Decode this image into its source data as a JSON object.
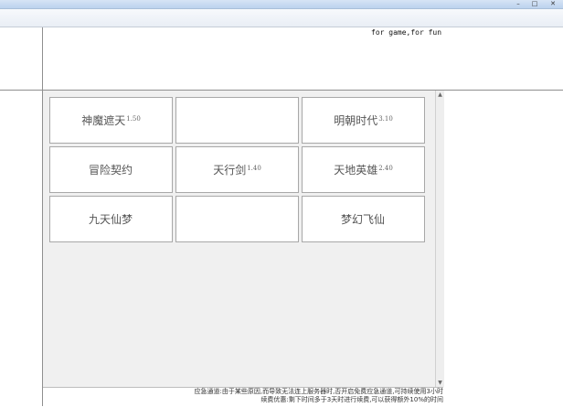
{
  "window": {
    "min_glyph": "–",
    "max_glyph": "□",
    "close_glyph": "✕"
  },
  "header": {
    "tagline": "for game,for fun"
  },
  "games": [
    {
      "name": "神魔遮天",
      "version": "1.50"
    },
    {
      "name": "",
      "version": ""
    },
    {
      "name": "明朝时代",
      "version": "3.10"
    },
    {
      "name": "冒险契约",
      "version": ""
    },
    {
      "name": "天行剑",
      "version": "1.40"
    },
    {
      "name": "天地英雄",
      "version": "2.40"
    },
    {
      "name": "九天仙梦",
      "version": ""
    },
    {
      "name": "",
      "version": ""
    },
    {
      "name": "梦幻飞仙",
      "version": ""
    }
  ],
  "scrollbar": {
    "up_glyph": "▲",
    "down_glyph": "▼"
  },
  "footer": {
    "notice_line1": "应急通道:由于某些原因,而导致无法连上服务器时,否开启免费应急通道,可持续使用3小时",
    "notice_line2": "续费优惠:剩下时间多于3天时进行续费,可以获得额外10%的时间"
  }
}
